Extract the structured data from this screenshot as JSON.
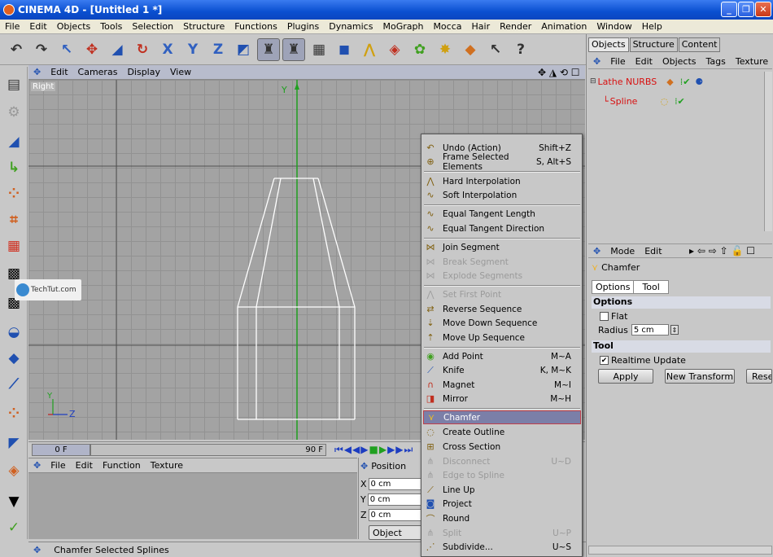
{
  "window": {
    "title": "CINEMA 4D - [Untitled 1 *]",
    "min": "_",
    "max": "❐",
    "close": "✕"
  },
  "menubar": [
    "File",
    "Edit",
    "Objects",
    "Tools",
    "Selection",
    "Structure",
    "Functions",
    "Plugins",
    "Dynamics",
    "MoGraph",
    "Mocca",
    "Hair",
    "Render",
    "Animation",
    "Window",
    "Help"
  ],
  "viewport": {
    "menu": [
      "Edit",
      "Cameras",
      "Display",
      "View"
    ],
    "label": "Right",
    "axis_y": "Y",
    "axis_z": "Z",
    "watermark": "TechTut.com"
  },
  "timeline": {
    "current": "0 F",
    "end": "90 F"
  },
  "materials": {
    "menu": [
      "File",
      "Edit",
      "Function",
      "Texture"
    ]
  },
  "coordinates": {
    "title": "Position",
    "rows": [
      {
        "axis": "X",
        "value": "0 cm"
      },
      {
        "axis": "Y",
        "value": "0 cm"
      },
      {
        "axis": "Z",
        "value": "0 cm"
      }
    ],
    "mode": "Object"
  },
  "status": "Chamfer Selected Splines",
  "context_menu": [
    {
      "label": "Undo (Action)",
      "shortcut": "Shift+Z",
      "enabled": true
    },
    {
      "label": "Frame Selected Elements",
      "shortcut": "S, Alt+S",
      "enabled": true
    },
    {
      "label": "Hard Interpolation",
      "shortcut": "",
      "enabled": true
    },
    {
      "label": "Soft Interpolation",
      "shortcut": "",
      "enabled": true
    },
    {
      "label": "Equal Tangent Length",
      "shortcut": "",
      "enabled": true
    },
    {
      "label": "Equal Tangent Direction",
      "shortcut": "",
      "enabled": true
    },
    {
      "label": "Join Segment",
      "shortcut": "",
      "enabled": true
    },
    {
      "label": "Break Segment",
      "shortcut": "",
      "enabled": false
    },
    {
      "label": "Explode Segments",
      "shortcut": "",
      "enabled": false
    },
    {
      "label": "Set First Point",
      "shortcut": "",
      "enabled": false
    },
    {
      "label": "Reverse Sequence",
      "shortcut": "",
      "enabled": true
    },
    {
      "label": "Move Down Sequence",
      "shortcut": "",
      "enabled": true
    },
    {
      "label": "Move Up Sequence",
      "shortcut": "",
      "enabled": true
    },
    {
      "label": "Add Point",
      "shortcut": "M~A",
      "enabled": true
    },
    {
      "label": "Knife",
      "shortcut": "K, M~K",
      "enabled": true
    },
    {
      "label": "Magnet",
      "shortcut": "M~I",
      "enabled": true
    },
    {
      "label": "Mirror",
      "shortcut": "M~H",
      "enabled": true
    },
    {
      "label": "Chamfer",
      "shortcut": "",
      "enabled": true,
      "highlighted": true
    },
    {
      "label": "Create Outline",
      "shortcut": "",
      "enabled": true
    },
    {
      "label": "Cross Section",
      "shortcut": "",
      "enabled": true
    },
    {
      "label": "Disconnect",
      "shortcut": "U~D",
      "enabled": false
    },
    {
      "label": "Edge to Spline",
      "shortcut": "",
      "enabled": false
    },
    {
      "label": "Line Up",
      "shortcut": "",
      "enabled": true
    },
    {
      "label": "Project",
      "shortcut": "",
      "enabled": true
    },
    {
      "label": "Round",
      "shortcut": "",
      "enabled": true
    },
    {
      "label": "Split",
      "shortcut": "U~P",
      "enabled": false
    },
    {
      "label": "Subdivide...",
      "shortcut": "U~S",
      "enabled": true
    }
  ],
  "object_manager": {
    "tabs": [
      "Objects",
      "Structure",
      "Content"
    ],
    "menu": [
      "File",
      "Edit",
      "Objects",
      "Tags",
      "Texture"
    ],
    "items": [
      {
        "name": "Lathe NURBS"
      },
      {
        "name": "Spline"
      }
    ]
  },
  "attributes": {
    "menu": [
      "Mode",
      "Edit"
    ],
    "tool_name": "Chamfer",
    "tabs": [
      "Options",
      "Tool"
    ],
    "options_header": "Options",
    "flat_label": "Flat",
    "radius_label": "Radius",
    "radius_value": "5 cm",
    "tool_header": "Tool",
    "realtime_label": "Realtime Update",
    "apply": "Apply",
    "new_transform": "New Transform",
    "reset": "Rese"
  }
}
